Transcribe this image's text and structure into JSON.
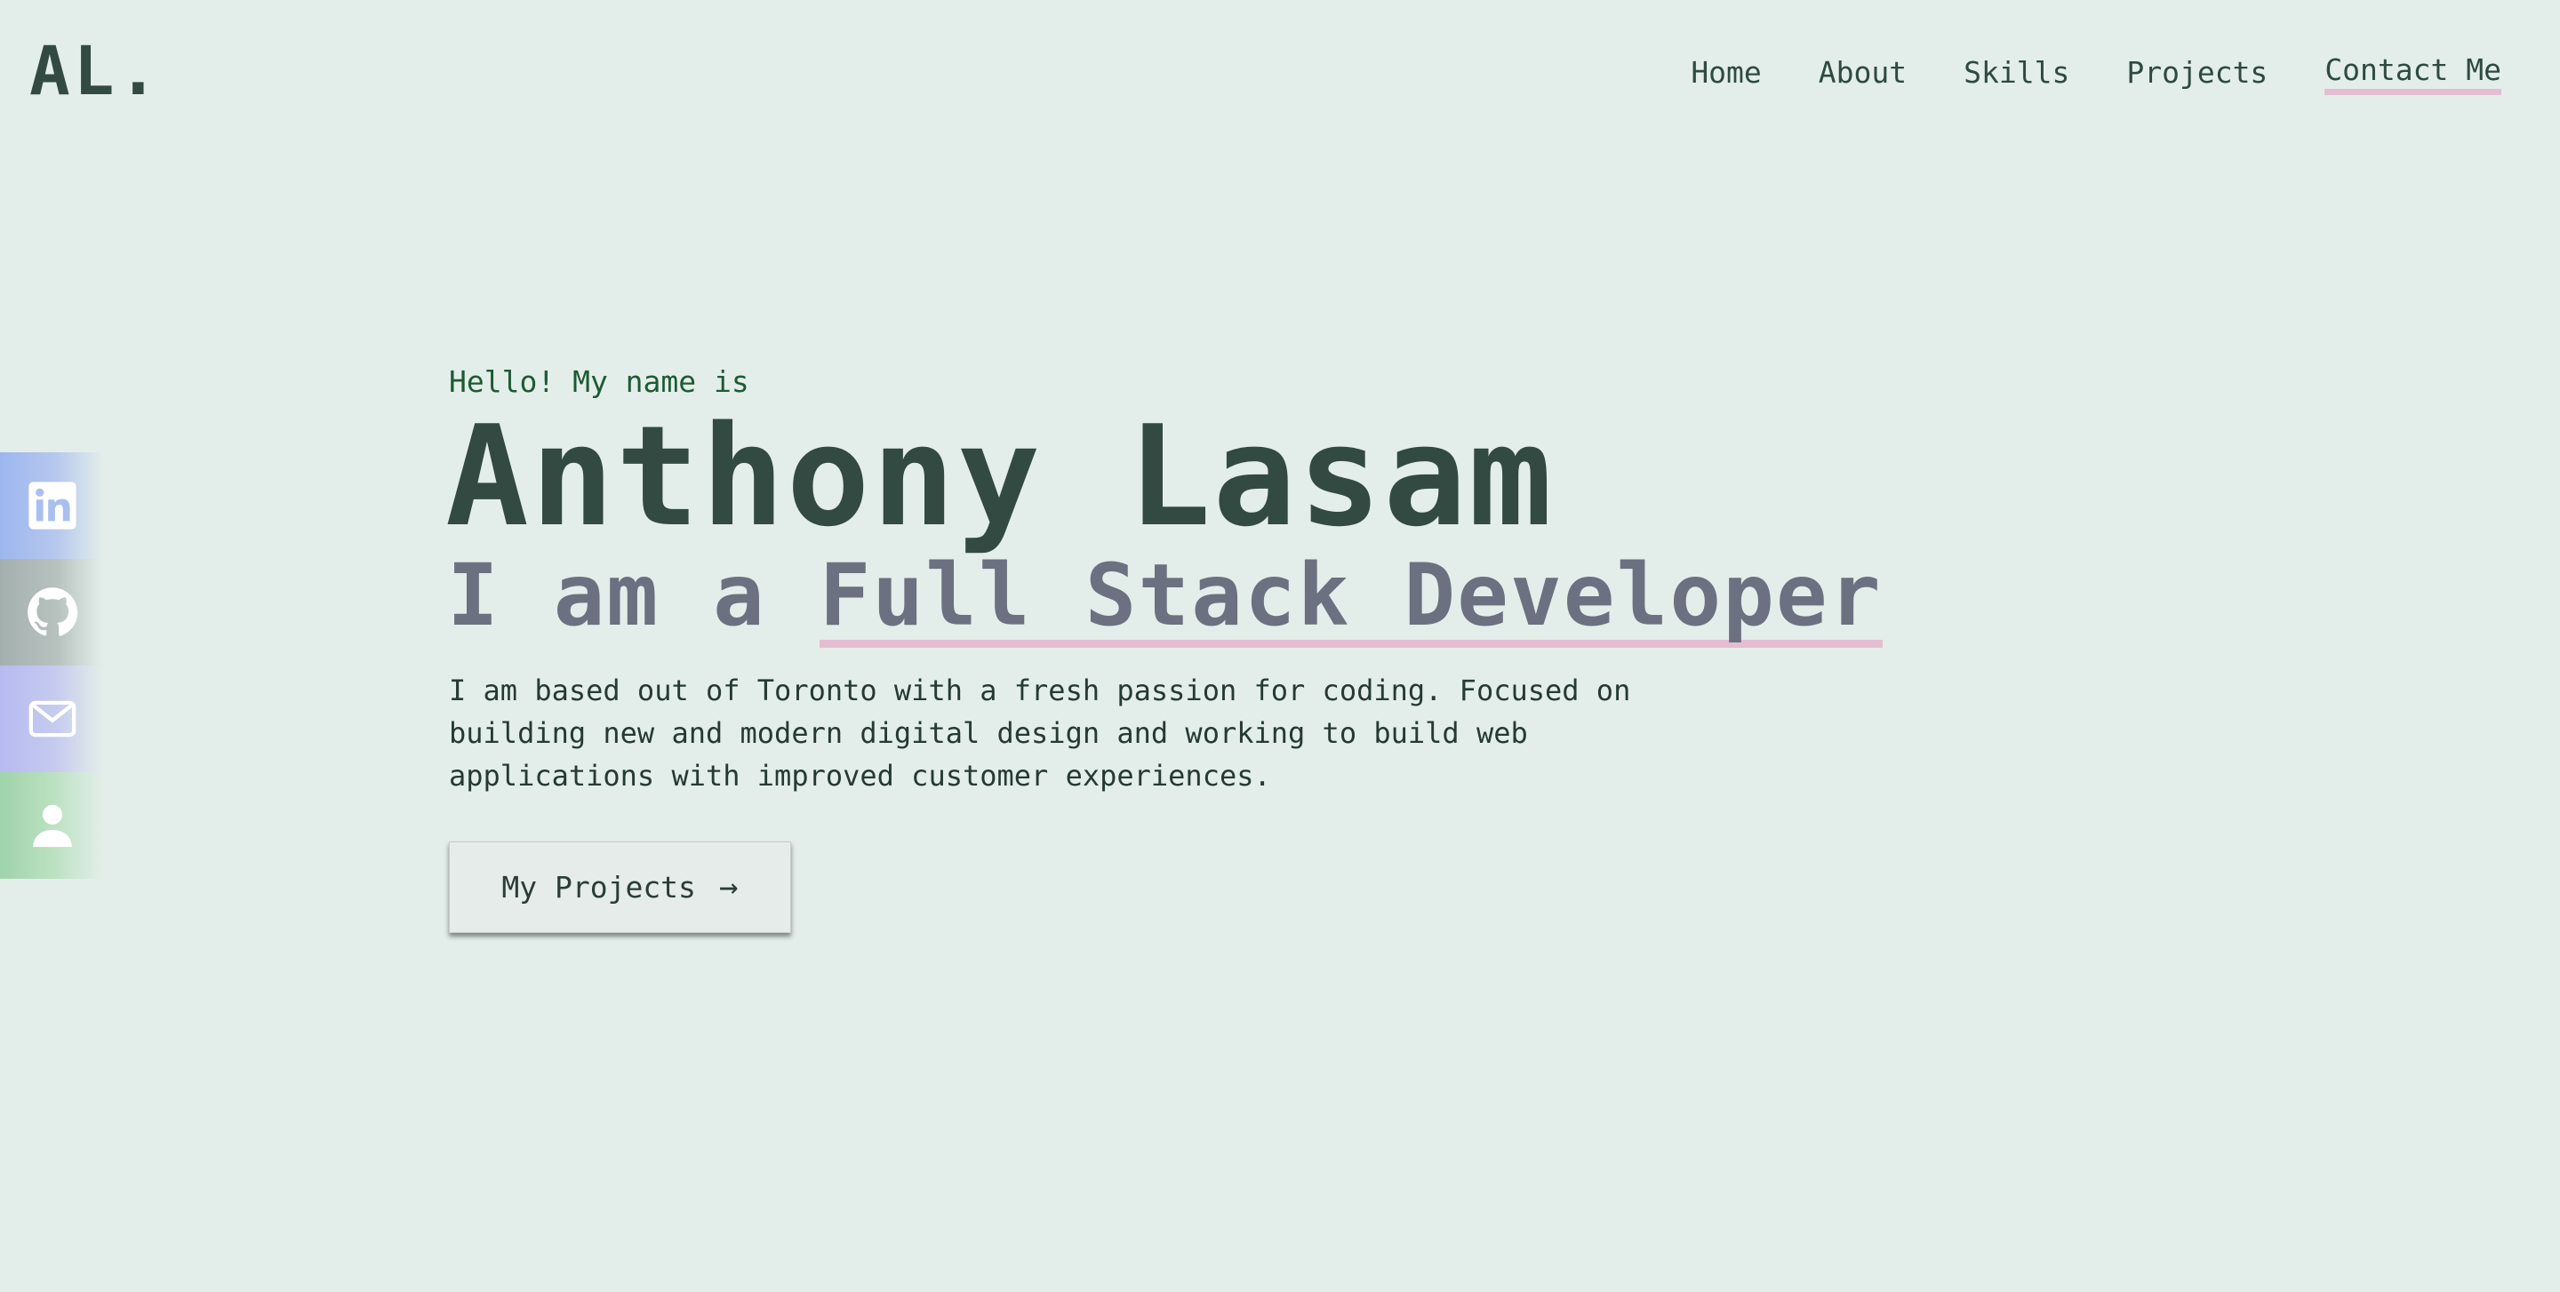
{
  "logo": "AL.",
  "nav": {
    "items": [
      {
        "label": "Home"
      },
      {
        "label": "About"
      },
      {
        "label": "Skills"
      },
      {
        "label": "Projects"
      },
      {
        "label": "Contact Me"
      }
    ]
  },
  "social": [
    {
      "icon": "linkedin-icon"
    },
    {
      "icon": "github-icon"
    },
    {
      "icon": "mail-icon"
    },
    {
      "icon": "person-icon"
    }
  ],
  "hero": {
    "greeting": "Hello! My name is",
    "name": "Anthony Lasam",
    "role_prefix": "I am a ",
    "role_highlight": "Full Stack Developer",
    "bio": "I am based out of Toronto with a fresh passion for coding. Focused on building new and modern digital design and working to build web applications with improved customer experiences.",
    "cta_label": "My Projects",
    "cta_icon": "arrow-right-icon"
  },
  "colors": {
    "background": "#e3eeea",
    "primary_text": "#334a42",
    "greeting": "#1e5a34",
    "role": "#6b7180",
    "highlight_underline": "#e4bdd1"
  }
}
